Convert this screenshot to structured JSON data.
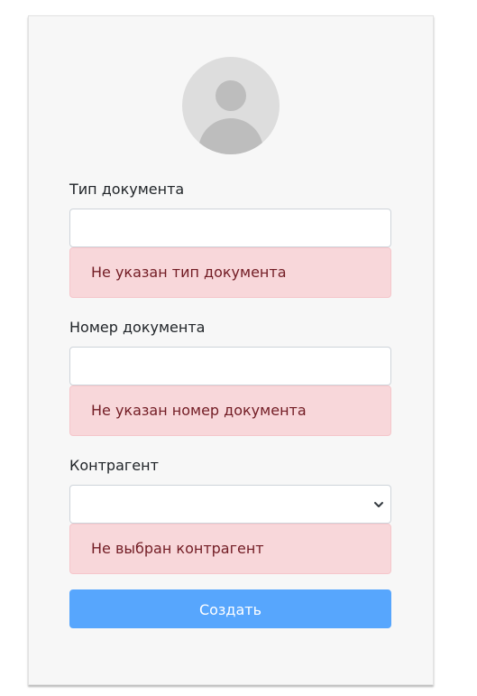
{
  "form": {
    "avatar_icon": "user-avatar-placeholder",
    "fields": [
      {
        "label": "Тип документа",
        "value": "",
        "placeholder": "",
        "error": "Не указан тип документа"
      },
      {
        "label": "Номер документа",
        "value": "",
        "placeholder": "",
        "error": "Не указан номер документа"
      },
      {
        "label": "Контрагент",
        "value": "",
        "error": "Не выбран контрагент"
      }
    ],
    "submit_label": "Создать"
  },
  "colors": {
    "card_bg": "#f7f7f7",
    "error_bg": "#f8d7da",
    "error_text": "#721c24",
    "button_bg": "#57a6fd",
    "avatar_bg": "#dddddd",
    "avatar_fg": "#bdbdbd"
  }
}
